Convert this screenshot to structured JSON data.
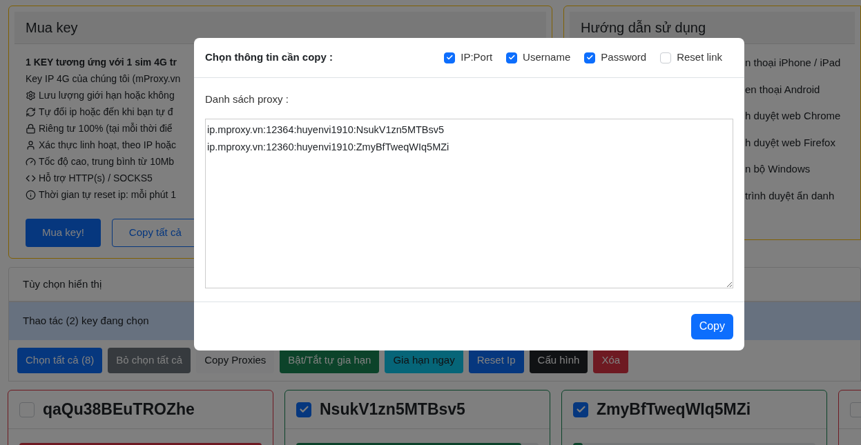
{
  "buy_card": {
    "title": "Mua key",
    "headline": "1 KEY tương ứng với 1 sim 4G tr",
    "features": [
      "Key IP 4G của chúng tôi (mProxy.vn",
      "Lưu lượng giới hạn hoặc không",
      "Tự đổi ip hoặc đến khi bạn tự đ",
      "Riêng tư 100% (tại mỗi thời điể",
      "Xác thực linh hoạt, theo IP hoặc",
      "Tốc độ cao, trung bình từ 10Mb",
      "Hỗ trợ HTTP(s) / SOCKS5",
      "Thời gian tự reset ip: mỗi phút 1"
    ],
    "buttons": [
      {
        "label": "Mua key!",
        "kind": "primary"
      },
      {
        "label": "Copy tất cả",
        "kind": "outline"
      }
    ]
  },
  "guide_card": {
    "title": "Hướng dẫn sử dụng",
    "items": [
      "n thoại iPhone / iPad",
      "en thoại Android",
      "h duyệt web Chrome",
      "h duyệt web Firefox",
      "n bộ Windows",
      "trình duyệt ẩn danh"
    ]
  },
  "display_options": {
    "label": "Tùy chọn hiển thị"
  },
  "bulk_actions": {
    "title": "Thao tác (2) key đang chọn",
    "buttons": [
      {
        "label": "Chọn tất cả (8)",
        "kind": "primary"
      },
      {
        "label": "Bỏ chọn tất cả",
        "kind": "secondary"
      },
      {
        "label": "Copy Proxies",
        "kind": "light"
      },
      {
        "label": "Bật/Tắt tự gia hạn",
        "kind": "success"
      },
      {
        "label": "Gia hạn ngay",
        "kind": "info"
      },
      {
        "label": "Reset Ip",
        "kind": "primary"
      },
      {
        "label": "Cấu hình",
        "kind": "dark"
      },
      {
        "label": "Xóa",
        "kind": "danger"
      }
    ]
  },
  "keys": [
    {
      "name": "qaQu38BEuTROZhe",
      "checked": false,
      "kind": "expired",
      "level": 1
    },
    {
      "name": "NsukV1zn5MTBsv5",
      "checked": true,
      "kind": "active",
      "level": 0.93
    },
    {
      "name": "ZmyBfTweqWIq5MZi",
      "checked": true,
      "kind": "active",
      "level": 0.04
    },
    {
      "checked": false,
      "kind": "expired"
    }
  ],
  "modal": {
    "title": "Chọn thông tin cần copy :",
    "options": [
      {
        "label": "IP:Port",
        "checked": true
      },
      {
        "label": "Username",
        "checked": true
      },
      {
        "label": "Password",
        "checked": true
      },
      {
        "label": "Reset link",
        "checked": false
      }
    ],
    "list_label": "Danh sách proxy :",
    "proxies": "ip.mproxy.vn:12364:huyenvi1910:NsukV1zn5MTBsv5\nip.mproxy.vn:12360:huyenvi1910:ZmyBfTweqWIq5MZi",
    "button": "Copy"
  }
}
